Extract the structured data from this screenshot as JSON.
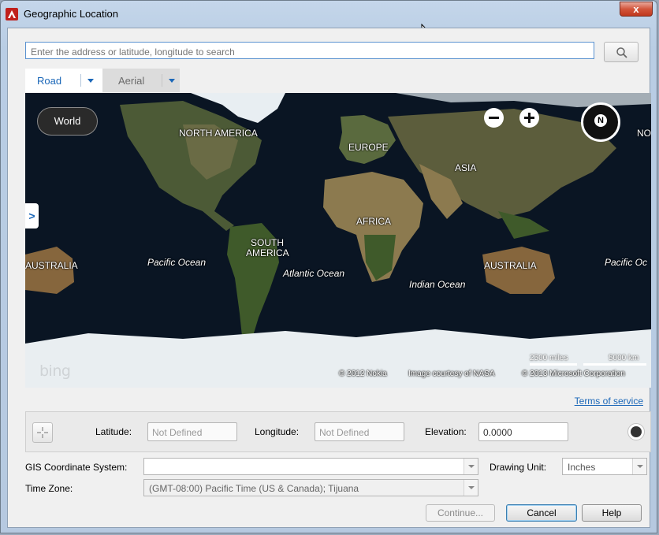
{
  "window": {
    "title": "Geographic Location",
    "close_glyph": "x"
  },
  "search": {
    "placeholder": "Enter the address or latitude, longitude to search",
    "button_icon": "search-icon"
  },
  "map_type": {
    "road_label": "Road",
    "aerial_label": "Aerial",
    "selected": "Road"
  },
  "map": {
    "world_button": "World",
    "zoom_out_icon": "zoom-out-icon",
    "zoom_in_icon": "zoom-in-icon",
    "compass_label": "N",
    "expander_glyph": ">",
    "labels": {
      "north_america": "NORTH AMERICA",
      "europe": "EUROPE",
      "asia": "ASIA",
      "africa": "AFRICA",
      "south_america_1": "SOUTH",
      "south_america_2": "AMERICA",
      "australia_left": "AUSTRALIA",
      "australia_right": "AUSTRALIA",
      "pacific_left": "Pacific Ocean",
      "pacific_right": "Pacific Oc",
      "atlantic": "Atlantic Ocean",
      "indian": "Indian Ocean",
      "north_partial": "NOR"
    },
    "logo": "bing",
    "attribution_nokia": "© 2012 Nokia",
    "attribution_nasa": "Image courtesy of NASA",
    "attribution_ms": "© 2013 Microsoft Corporation",
    "scale_miles": "2500 miles",
    "scale_km": "5000 km"
  },
  "terms_link": "Terms of service",
  "coordinates": {
    "latitude_label": "Latitude:",
    "latitude_value": "Not Defined",
    "longitude_label": "Longitude:",
    "longitude_value": "Not Defined",
    "elevation_label": "Elevation:",
    "elevation_value": "0.0000"
  },
  "settings": {
    "gis_label": "GIS Coordinate System:",
    "gis_value": "",
    "drawing_unit_label": "Drawing Unit:",
    "drawing_unit_value": "Inches",
    "time_zone_label": "Time Zone:",
    "time_zone_value": "(GMT-08:00) Pacific Time (US & Canada); Tijuana"
  },
  "buttons": {
    "continue": "Continue...",
    "cancel": "Cancel",
    "help": "Help"
  }
}
